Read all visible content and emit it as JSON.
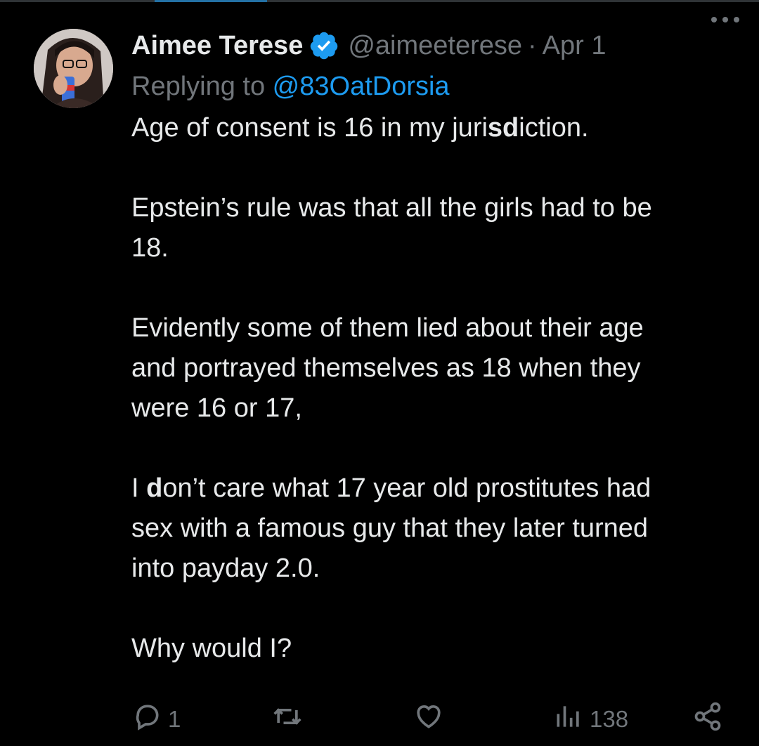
{
  "tweet": {
    "author": {
      "display_name": "Aimee Terese",
      "handle": "@aimeeterese",
      "verified_icon": "verified-badge-icon"
    },
    "separator": "·",
    "date": "Apr 1",
    "reply": {
      "prefix": "Replying to ",
      "to": "@83OatDorsia"
    },
    "paragraphs": {
      "p1": {
        "before": "Age of consent is 16 in my juri",
        "bold": "sd",
        "after": "iction."
      },
      "p2": {
        "line1": "Epstein’s rule was that all the girls had to be",
        "line2": "18."
      },
      "p3": {
        "line1": "Evidently some of them lied about their age",
        "line2": "and portrayed themselves as 18 when they",
        "line3": "were 16 or 17,"
      },
      "p4": {
        "before": "I ",
        "bold": "d",
        "after": "on’t care what 17 year old prostitutes had",
        "line2": "sex with a famous guy that they later turned",
        "line3": "into payday 2.0."
      },
      "p5": {
        "line1": "Why would I?"
      }
    },
    "actions": {
      "reply_count": "1",
      "retweet_count": "",
      "like_count": "",
      "view_count": "138"
    }
  },
  "colors": {
    "background": "#000000",
    "text": "#e7e9ea",
    "secondary": "#71767b",
    "accent": "#1d9bf0"
  }
}
